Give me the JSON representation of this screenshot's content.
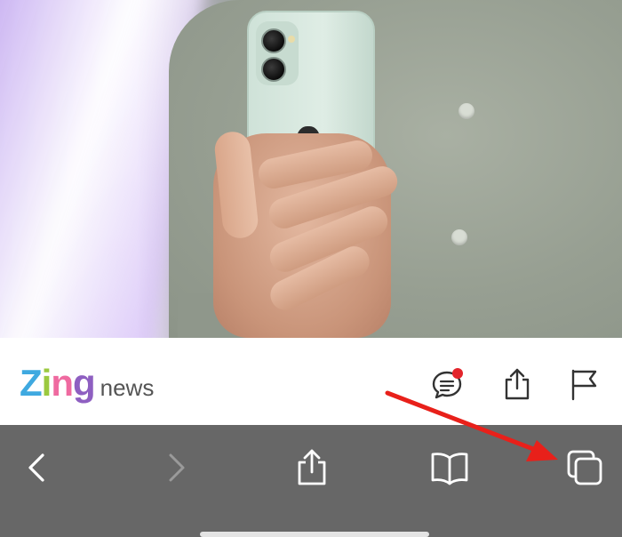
{
  "hero_image": {
    "description_icon": "photo-of-person-holding-green-iphone"
  },
  "article_bar": {
    "logo": {
      "letters": [
        "Z",
        "i",
        "n",
        "g"
      ],
      "letter_colors": [
        "#3fa9e0",
        "#9bc93f",
        "#ef6aa0",
        "#8e5fc1"
      ],
      "suffix": "news"
    },
    "icons": {
      "comments": "comment-bubble-icon",
      "comments_badge_color": "#e3242b",
      "share": "share-icon",
      "report": "flag-icon"
    }
  },
  "browser_toolbar": {
    "buttons": [
      "back-icon",
      "forward-icon",
      "share-icon",
      "bookmarks-icon",
      "tabs-icon"
    ],
    "back_enabled": true,
    "forward_enabled": false,
    "background": "#676767"
  },
  "annotation": {
    "arrow_color": "#e8201a",
    "points_to": "tabs-icon"
  }
}
